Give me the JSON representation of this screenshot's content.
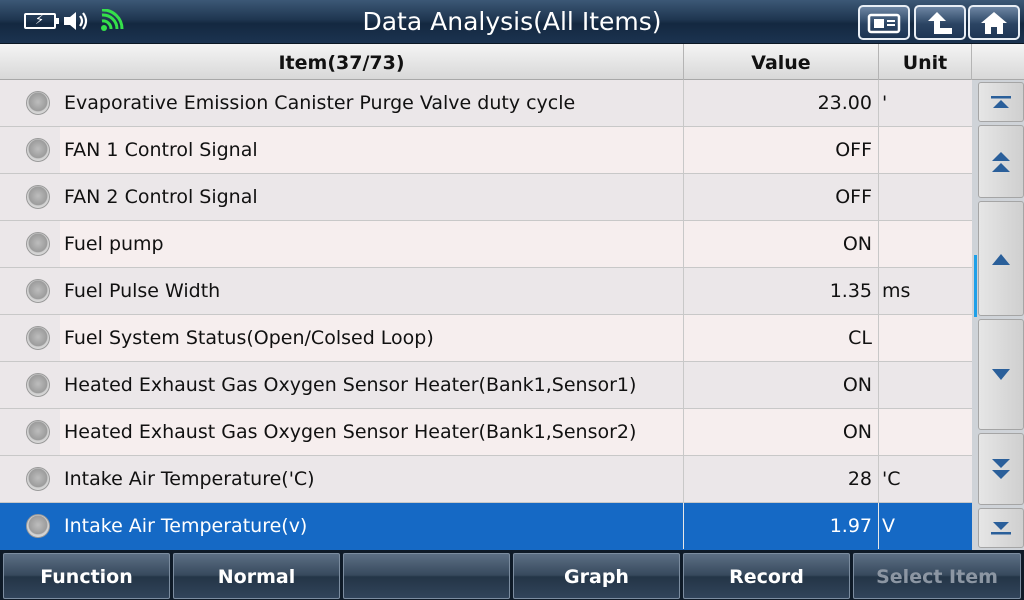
{
  "header": {
    "title": "Data Analysis(All Items)",
    "icons": [
      "battery-icon",
      "speaker-icon",
      "wifi-icon"
    ],
    "buttons": [
      "screenshot-icon",
      "back-icon",
      "home-icon"
    ]
  },
  "table": {
    "headers": {
      "item": "Item(37/73)",
      "value": "Value",
      "unit": "Unit"
    },
    "rows": [
      {
        "item": "Evaporative Emission Canister Purge Valve duty cycle",
        "value": "23.00",
        "unit": "'"
      },
      {
        "item": "FAN 1 Control Signal",
        "value": "OFF",
        "unit": ""
      },
      {
        "item": "FAN 2 Control Signal",
        "value": "OFF",
        "unit": ""
      },
      {
        "item": "Fuel pump",
        "value": "ON",
        "unit": ""
      },
      {
        "item": "Fuel Pulse Width",
        "value": "1.35",
        "unit": "ms"
      },
      {
        "item": "Fuel System Status(Open/Colsed Loop)",
        "value": "CL",
        "unit": ""
      },
      {
        "item": "Heated Exhaust Gas Oxygen Sensor Heater(Bank1,Sensor1)",
        "value": "ON",
        "unit": ""
      },
      {
        "item": "Heated Exhaust Gas Oxygen Sensor Heater(Bank1,Sensor2)",
        "value": "ON",
        "unit": ""
      },
      {
        "item": "Intake Air Temperature('C)",
        "value": "28",
        "unit": "'C"
      },
      {
        "item": "Intake Air Temperature(v)",
        "value": "1.97",
        "unit": "V"
      }
    ],
    "selected_index": 9
  },
  "toolbar": {
    "function": "Function",
    "normal": "Normal",
    "blank": "",
    "graph": "Graph",
    "record": "Record",
    "select_item": "Select Item"
  },
  "colors": {
    "selected_row": "#1569c5",
    "scroll_thumb": "#1fa0e8",
    "wifi": "#35e04a"
  }
}
